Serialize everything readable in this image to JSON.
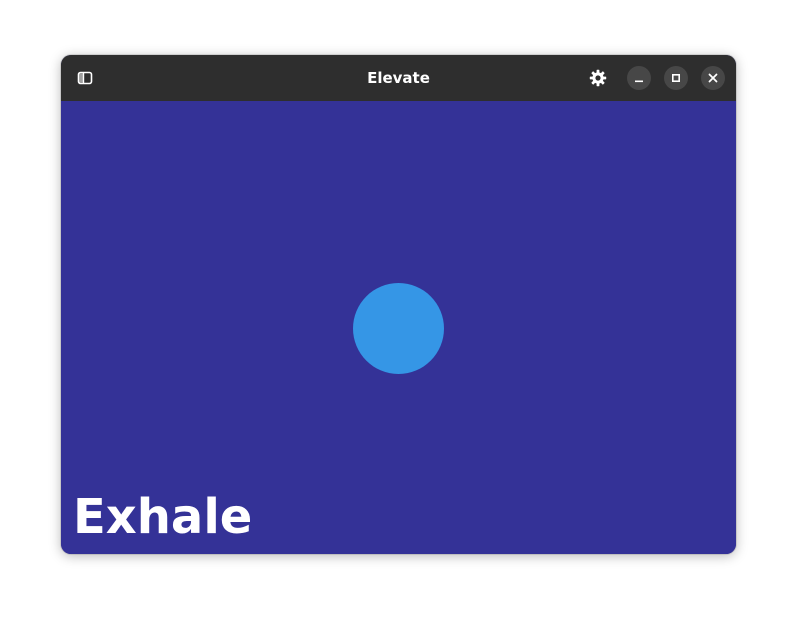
{
  "window": {
    "title": "Elevate"
  },
  "titlebar": {
    "sidebar_toggle_icon": "sidebar-icon",
    "settings_icon": "gear-icon",
    "minimize_icon": "minimize-icon",
    "maximize_icon": "maximize-icon",
    "close_icon": "close-icon"
  },
  "breathing": {
    "phase": "Exhale",
    "circle_color": "#3596e6",
    "background_color": "#343297"
  }
}
